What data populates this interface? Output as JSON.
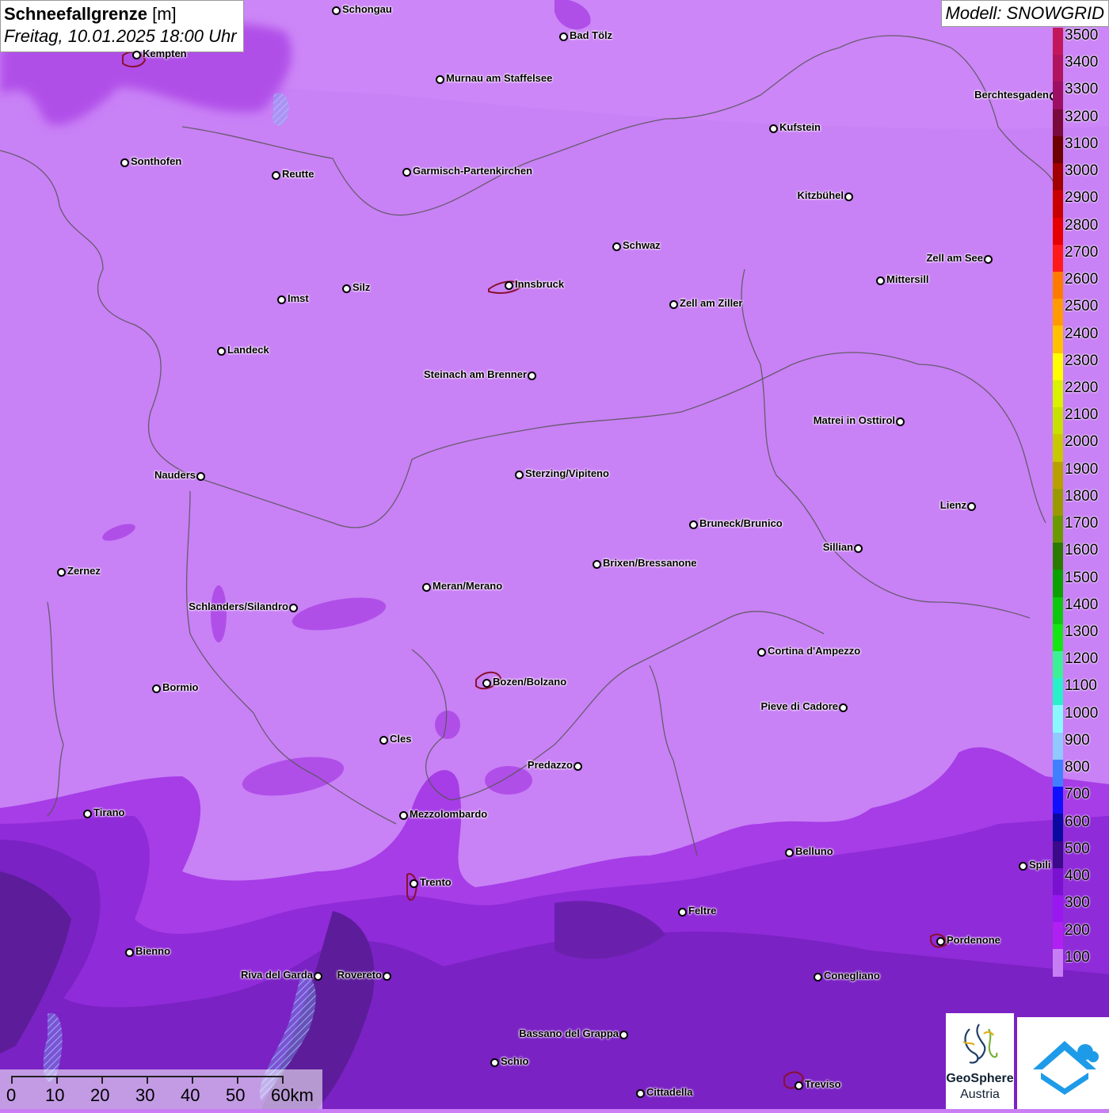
{
  "header": {
    "title": "Schneefallgrenze",
    "unit": "[m]",
    "datetime": "Freitag, 10.01.2025 18:00 Uhr"
  },
  "model": "Modell: SNOWGRID",
  "legend": {
    "labels": [
      "3500",
      "3400",
      "3300",
      "3200",
      "3100",
      "3000",
      "2900",
      "2800",
      "2700",
      "2600",
      "2500",
      "2400",
      "2300",
      "2200",
      "2100",
      "2000",
      "1900",
      "1800",
      "1700",
      "1600",
      "1500",
      "1400",
      "1300",
      "1200",
      "1100",
      "1000",
      "900",
      "800",
      "700",
      "600",
      "500",
      "400",
      "300",
      "200",
      "100"
    ],
    "colors": [
      "#c2185b",
      "#b0145f",
      "#9c0f63",
      "#7a0a3c",
      "#6d0000",
      "#a00000",
      "#c80000",
      "#e60000",
      "#ff1a1a",
      "#ff7a00",
      "#ff9a00",
      "#ffc000",
      "#ffff00",
      "#d9f200",
      "#c8e000",
      "#c8c800",
      "#b8a000",
      "#9a9a00",
      "#6a9a00",
      "#2a7a00",
      "#0aa000",
      "#0cc80c",
      "#14e614",
      "#3cf096",
      "#28f0c8",
      "#8af8ff",
      "#90c8ff",
      "#4080ff",
      "#1010ff",
      "#0a0aa0",
      "#3a0a8a",
      "#7a10d0",
      "#9a18f0",
      "#b020f0",
      "#c77ef5"
    ]
  },
  "cities": [
    {
      "name": "Schongau",
      "label_side": "right"
    },
    {
      "name": "Bad Tölz",
      "label_side": "right"
    },
    {
      "name": "Kempten",
      "label_side": "right"
    },
    {
      "name": "Murnau am Staffelsee",
      "label_side": "right"
    },
    {
      "name": "Berchtesgaden",
      "label_side": "left"
    },
    {
      "name": "Kufstein",
      "label_side": "right"
    },
    {
      "name": "Sonthofen",
      "label_side": "right"
    },
    {
      "name": "Reutte",
      "label_side": "right"
    },
    {
      "name": "Garmisch-Partenkirchen",
      "label_side": "right"
    },
    {
      "name": "Kitzbühel",
      "label_side": "left"
    },
    {
      "name": "Schwaz",
      "label_side": "right"
    },
    {
      "name": "Zell am See",
      "label_side": "left"
    },
    {
      "name": "Mittersill",
      "label_side": "right"
    },
    {
      "name": "Innsbruck",
      "label_side": "right"
    },
    {
      "name": "Imst",
      "label_side": "right"
    },
    {
      "name": "Silz",
      "label_side": "right"
    },
    {
      "name": "Zell am Ziller",
      "label_side": "right"
    },
    {
      "name": "Landeck",
      "label_side": "right"
    },
    {
      "name": "Steinach am Brenner",
      "label_side": "left"
    },
    {
      "name": "Matrei in Osttirol",
      "label_side": "left"
    },
    {
      "name": "Nauders",
      "label_side": "left"
    },
    {
      "name": "Sterzing/Vipiteno",
      "label_side": "right"
    },
    {
      "name": "Lienz",
      "label_side": "left"
    },
    {
      "name": "Bruneck/Brunico",
      "label_side": "right"
    },
    {
      "name": "Sillian",
      "label_side": "left"
    },
    {
      "name": "Brixen/Bressanone",
      "label_side": "right"
    },
    {
      "name": "Zernez",
      "label_side": "right"
    },
    {
      "name": "Meran/Merano",
      "label_side": "right"
    },
    {
      "name": "Schlanders/Silandro",
      "label_side": "left"
    },
    {
      "name": "Cortina d'Ampezzo",
      "label_side": "right"
    },
    {
      "name": "Bozen/Bolzano",
      "label_side": "right"
    },
    {
      "name": "Bormio",
      "label_side": "right"
    },
    {
      "name": "Pieve di Cadore",
      "label_side": "left"
    },
    {
      "name": "Cles",
      "label_side": "right"
    },
    {
      "name": "Predazzo",
      "label_side": "left"
    },
    {
      "name": "Tirano",
      "label_side": "right"
    },
    {
      "name": "Mezzolombardo",
      "label_side": "right"
    },
    {
      "name": "Belluno",
      "label_side": "right"
    },
    {
      "name": "Spili",
      "label_side": "right"
    },
    {
      "name": "Trento",
      "label_side": "right"
    },
    {
      "name": "Feltre",
      "label_side": "right"
    },
    {
      "name": "Pordenone",
      "label_side": "right"
    },
    {
      "name": "Bienno",
      "label_side": "right"
    },
    {
      "name": "Riva del Garda",
      "label_side": "left"
    },
    {
      "name": "Rovereto",
      "label_side": "left"
    },
    {
      "name": "Conegliano",
      "label_side": "right"
    },
    {
      "name": "Bassano del Grappa",
      "label_side": "left"
    },
    {
      "name": "Schio",
      "label_side": "right"
    },
    {
      "name": "Treviso",
      "label_side": "right"
    },
    {
      "name": "Cittadella",
      "label_side": "right"
    }
  ],
  "scalebar": {
    "labels": [
      "0",
      "10",
      "20",
      "30",
      "40",
      "50",
      "60km"
    ]
  },
  "logos": {
    "geosphere_line1": "GeoSphere",
    "geosphere_line2": "Austria"
  }
}
